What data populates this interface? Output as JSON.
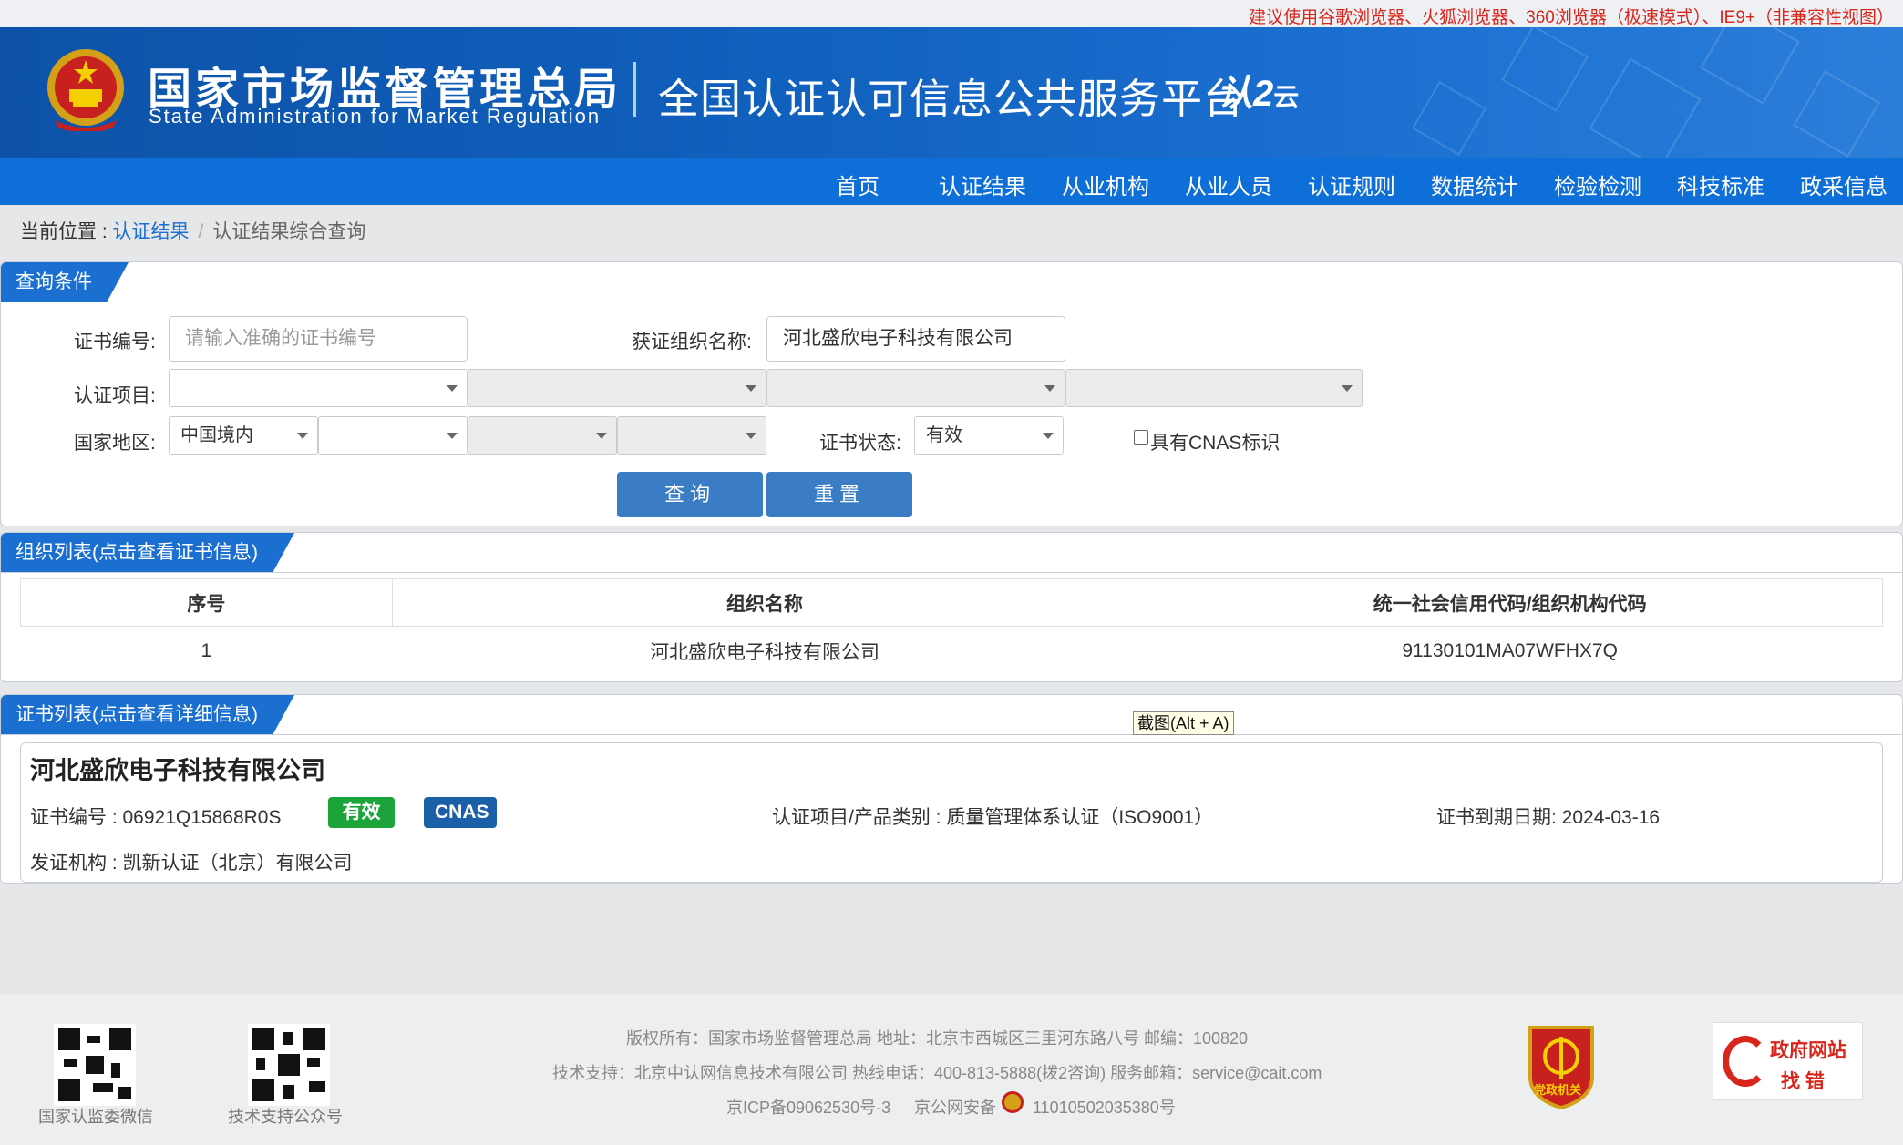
{
  "notice": "建议使用谷歌浏览器、火狐浏览器、360浏览器（极速模式）、IE9+（非兼容性视图）",
  "header": {
    "org_cn": "国家市场监督管理总局",
    "org_en": "State Administration  for  Market Regulation",
    "platform": "全国认证认可信息公共服务平台",
    "brand_logo_main": "认",
    "brand_logo_sub": "云"
  },
  "nav": [
    "首页",
    "认证结果",
    "从业机构",
    "从业人员",
    "认证规则",
    "数据统计",
    "检验检测",
    "科技标准",
    "政采信息"
  ],
  "breadcrumb": {
    "prefix": "当前位置 : ",
    "link": "认证结果",
    "current": "认证结果综合查询"
  },
  "query": {
    "tab": "查询条件",
    "cert_no_label": "证书编号:",
    "cert_no_placeholder": "请输入准确的证书编号",
    "org_name_label": "获证组织名称:",
    "org_name_value": "河北盛欣电子科技有限公司",
    "project_label": "认证项目:",
    "region_label": "国家地区:",
    "region_value": "中国境内",
    "status_label": "证书状态:",
    "status_value": "有效",
    "cnas_label": "具有CNAS标识",
    "search_btn": "查询",
    "reset_btn": "重置"
  },
  "org_list": {
    "tab": "组织列表(点击查看证书信息)",
    "columns": [
      "序号",
      "组织名称",
      "统一社会信用代码/组织机构代码"
    ],
    "rows": [
      [
        "1",
        "河北盛欣电子科技有限公司",
        "91130101MA07WFHX7Q"
      ]
    ]
  },
  "cert_list": {
    "tab": "证书列表(点击查看详细信息)",
    "tooltip": "截图(Alt + A)",
    "company": "河北盛欣电子科技有限公司",
    "cert_no": "证书编号 : 06921Q15868R0S",
    "status_badge": "有效",
    "cnas_badge": "CNAS",
    "project": "认证项目/产品类别 : 质量管理体系认证（ISO9001）",
    "expire": "证书到期日期: 2024-03-16",
    "issuer": "发证机构 : 凯新认证（北京）有限公司"
  },
  "footer": {
    "qr1_label": "国家认监委微信",
    "qr2_label": "技术支持公众号",
    "line1": "版权所有：国家市场监督管理总局    地址：北京市西城区三里河东路八号    邮编：100820",
    "line2": "技术支持：北京中认网信息技术有限公司    热线电话：400-813-5888(拨2咨询)    服务邮箱：service@cait.com",
    "icp": "京ICP备09062530号-3",
    "police": "京公网安备",
    "police_no": "11010502035380号",
    "party_badge": "党政机关",
    "gov_line1": "政府网站",
    "gov_line2": "找 错"
  },
  "colors": {
    "brand_blue": "#0f6fd8",
    "valid_green": "#1aa43a",
    "cnas_blue": "#1a5fa8",
    "notice_red": "#d9261c"
  }
}
